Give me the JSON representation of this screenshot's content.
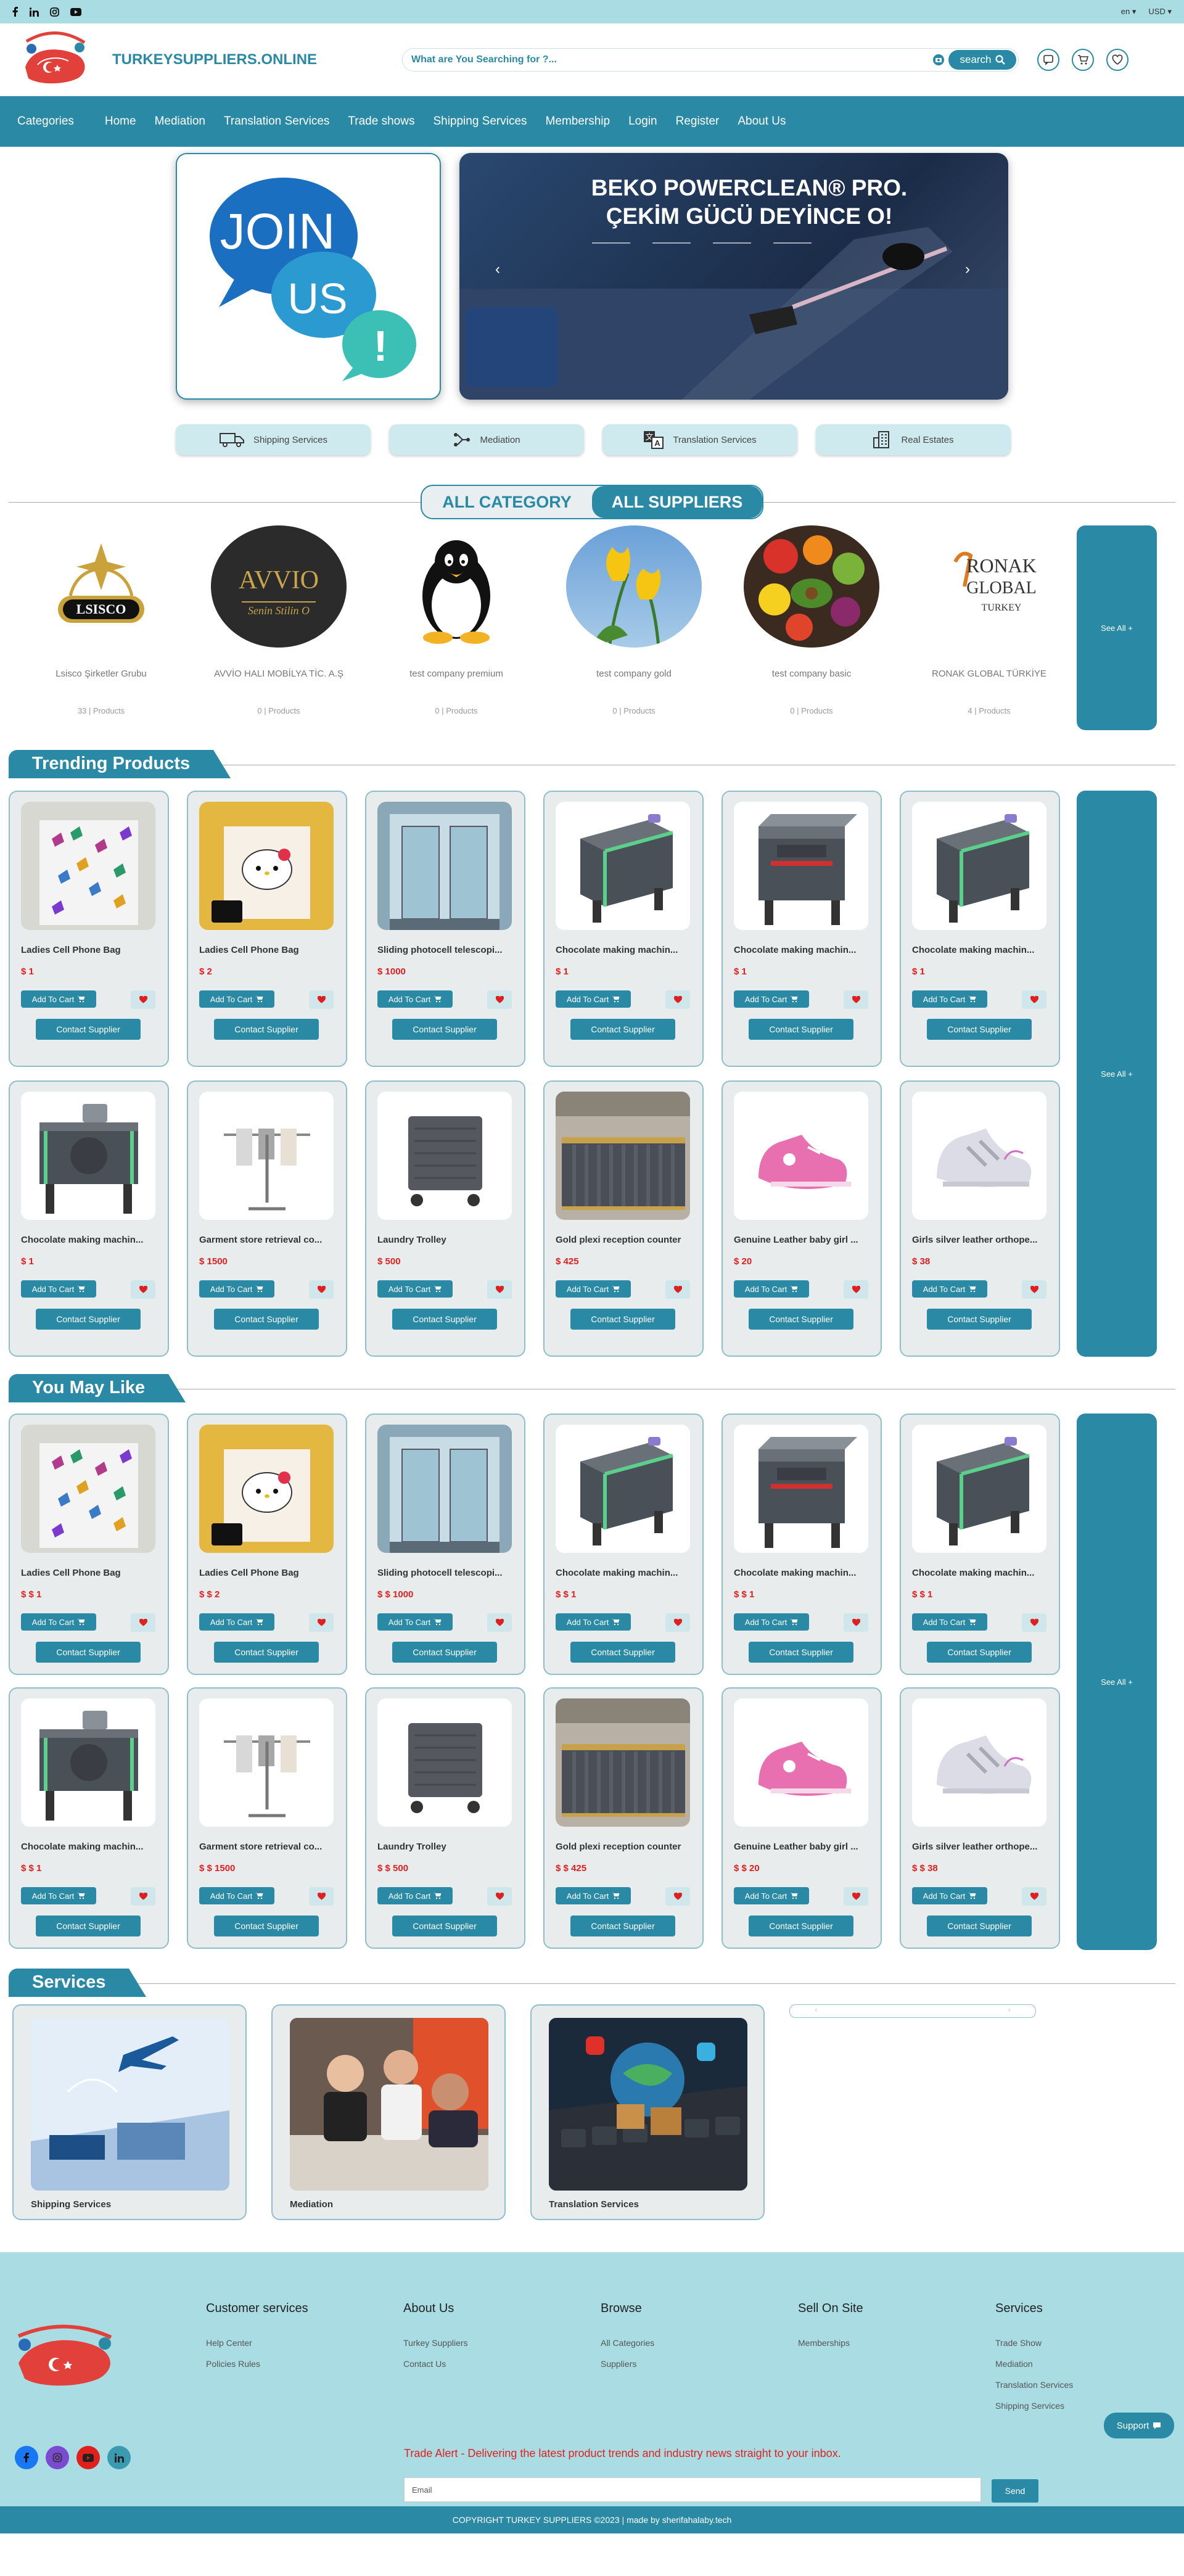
{
  "topbar": {
    "lang": "en ▾",
    "currency": "USD ▾",
    "social": [
      "facebook-icon",
      "linkedin-icon",
      "instagram-icon",
      "youtube-icon"
    ]
  },
  "header": {
    "brand": "TURKEYSUPPLIERS.ONLINE",
    "search_placeholder": "What are You Searching for ?...",
    "search_label": "search"
  },
  "nav": {
    "categories": "Categories",
    "items": [
      "Home",
      "Mediation",
      "Translation Services",
      "Trade shows",
      "Shipping Services",
      "Membership",
      "Login",
      "Register",
      "About Us"
    ]
  },
  "hero": {
    "join": [
      "JOIN",
      "US",
      "!"
    ],
    "banner_line1": "BEKO POWERCLEAN® PRO.",
    "banner_line2": "ÇEKİM GÜCÜ DEYİNCE O!"
  },
  "quick": [
    "Shipping Services",
    "Mediation",
    "Translation Services",
    "Real Estates"
  ],
  "toggle": {
    "a": "ALL CATEGORY",
    "b": "ALL SUPPLIERS"
  },
  "suppliers": [
    {
      "name": "Lsisco Şirketler Grubu",
      "count": "33 | Products",
      "logo": "LSISCO"
    },
    {
      "name": "AVVİO HALI MOBİLYA TİC. A.Ş",
      "count": "0 | Products",
      "logo": "AVVIO"
    },
    {
      "name": "test company premium",
      "count": "0 | Products",
      "logo": "penguin"
    },
    {
      "name": "test company gold",
      "count": "0 | Products",
      "logo": "tulip"
    },
    {
      "name": "test company basic",
      "count": "0 | Products",
      "logo": "fruit"
    },
    {
      "name": "RONAK GLOBAL TÜRKİYE",
      "count": "4 | Products",
      "logo": "RONAK"
    }
  ],
  "see_all": "See All +",
  "trending": {
    "title": "Trending Products",
    "prices": [
      "$ 1",
      "$ 2",
      "$ 1000",
      "$ 1",
      "$ 1",
      "$ 1",
      "$ 1",
      "$ 1500",
      "$ 500",
      "$ 425",
      "$ 20",
      "$ 38"
    ]
  },
  "youmaylike": {
    "title": "You May Like",
    "prices": [
      "$ $ 1",
      "$ $ 2",
      "$ $ 1000",
      "$ $ 1",
      "$ $ 1",
      "$ $ 1",
      "$ $ 1",
      "$ $ 1500",
      "$ $ 500",
      "$ $ 425",
      "$ $ 20",
      "$ $ 38"
    ]
  },
  "products": [
    "Ladies Cell Phone Bag",
    "Ladies Cell Phone Bag",
    "Sliding photocell telescopi...",
    "Chocolate making machin...",
    "Chocolate making machin...",
    "Chocolate making machin...",
    "Chocolate making machin...",
    "Garment store retrieval co...",
    "Laundry Trolley",
    "Gold plexi reception counter",
    "Genuine Leather baby girl ...",
    "Girls silver leather orthope..."
  ],
  "product_images": [
    "butterfly-bag",
    "kitty-bag",
    "glass-door",
    "machine",
    "machine-red",
    "machine",
    "machine-side",
    "garment",
    "trolley",
    "counter",
    "pink-shoe",
    "silver-shoe"
  ],
  "add_to_cart": "Add To Cart",
  "contact_supplier": "Contact Supplier",
  "services": {
    "title": "Services",
    "items": [
      "Shipping Services",
      "Mediation",
      "Translation Services"
    ]
  },
  "footer": {
    "cols": [
      {
        "title": "Customer services",
        "links": [
          "Help Center",
          "Policies Rules"
        ]
      },
      {
        "title": "About Us",
        "links": [
          "Turkey Suppliers",
          "Contact Us"
        ]
      },
      {
        "title": "Browse",
        "links": [
          "All Categories",
          "Suppliers"
        ]
      },
      {
        "title": "Sell On Site",
        "links": [
          "Memberships"
        ]
      },
      {
        "title": "Services",
        "links": [
          "Trade Show",
          "Mediation",
          "Translation Services",
          "Shipping Services"
        ]
      }
    ],
    "alert": "Trade Alert - Delivering the latest product trends and industry news straight to your inbox.",
    "email_placeholder": "Email",
    "send": "Send",
    "support": "Support",
    "copyright": "COPYRIGHT TURKEY SUPPLIERS ©2023 | made by sherifahalaby.tech"
  },
  "colors": {
    "primary": "#2a8aa5",
    "topbar": "#a9dde3",
    "price": "#e02020"
  }
}
